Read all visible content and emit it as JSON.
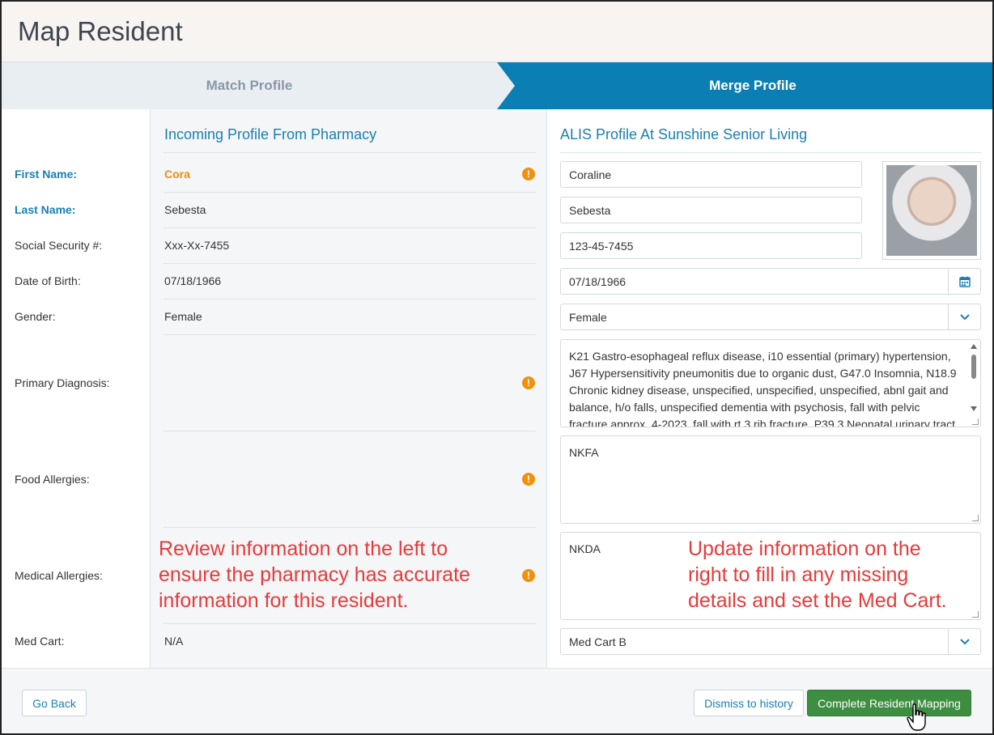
{
  "header": {
    "title": "Map Resident"
  },
  "steps": {
    "match": "Match Profile",
    "merge": "Merge Profile"
  },
  "columns": {
    "incoming_title": "Incoming Profile From Pharmacy",
    "alis_title": "ALIS Profile At Sunshine Senior Living"
  },
  "fields": {
    "first_name": {
      "label": "First Name:",
      "incoming": "Cora",
      "alis": "Coraline"
    },
    "last_name": {
      "label": "Last Name:",
      "incoming": "Sebesta",
      "alis": "Sebesta"
    },
    "ssn": {
      "label": "Social Security #:",
      "incoming": "Xxx-Xx-7455",
      "alis": "123-45-7455"
    },
    "dob": {
      "label": "Date of Birth:",
      "incoming": "07/18/1966",
      "alis": "07/18/1966"
    },
    "gender": {
      "label": "Gender:",
      "incoming": "Female",
      "alis": "Female"
    },
    "primary_diagnosis": {
      "label": "Primary Diagnosis:",
      "incoming": "",
      "alis": "K21 Gastro-esophageal reflux disease, i10 essential (primary) hypertension, J67 Hypersensitivity pneumonitis due to organic dust, G47.0 Insomnia, N18.9 Chronic kidney disease, unspecified, unspecified, unspecified, abnl gait and balance, h/o falls, unspecified dementia with psychosis, fall with pelvic fracture approx. 4-2023, fall with rt 3 rib fracture, P39.3 Neonatal urinary tract"
    },
    "food_allergies": {
      "label": "Food Allergies:",
      "incoming": "",
      "alis": "NKFA"
    },
    "medical_allergies": {
      "label": "Medical Allergies:",
      "incoming": "",
      "alis": "NKDA"
    },
    "med_cart": {
      "label": "Med Cart:",
      "incoming": "N/A",
      "alis": "Med Cart B"
    }
  },
  "annotations": {
    "left": [
      "Review information on the left to",
      "ensure the pharmacy has accurate",
      "information for this resident."
    ],
    "right": [
      "Update information on the",
      "right to fill in any missing",
      "details and set the Med Cart."
    ]
  },
  "icons": {
    "warning": "!",
    "calendar": "calendar-icon",
    "chevron": "chevron-down-icon"
  },
  "footer": {
    "go_back": "Go Back",
    "dismiss": "Dismiss to history",
    "complete": "Complete Resident Mapping"
  },
  "colors": {
    "accent": "#0b7eb4",
    "warning": "#f0900f",
    "success": "#3e8e41",
    "annotation": "#e53b3b"
  }
}
